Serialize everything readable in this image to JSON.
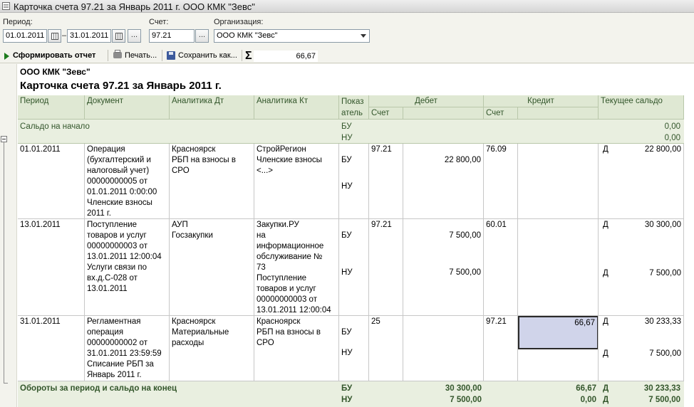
{
  "window": {
    "title": "Карточка счета 97.21 за Январь 2011 г. ООО КМК \"Зевс\""
  },
  "filters": {
    "period_label": "Период:",
    "date_from": "01.01.2011",
    "date_sep": "–",
    "date_to": "31.01.2011",
    "more_button": "...",
    "account_label": "Счет:",
    "account": "97.21",
    "org_label": "Организация:",
    "org": "ООО КМК \"Зевс\""
  },
  "toolbar": {
    "generate": "Сформировать отчет",
    "print": "Печать...",
    "save": "Сохранить как...",
    "sigma": "Σ",
    "sum": "66,67"
  },
  "report": {
    "org": "ООО КМК \"Зевс\"",
    "title": "Карточка счета 97.21 за Январь 2011 г.",
    "headers": {
      "period": "Период",
      "document": "Документ",
      "an_dt": "Аналитика Дт",
      "an_kt": "Аналитика Кт",
      "ind": "Показ\nатель",
      "debit": "Дебет",
      "debit_acc": "Счет",
      "credit": "Кредит",
      "credit_acc": "Счет",
      "balance": "Текущее сальдо"
    },
    "opening": {
      "label": "Сальдо на начало",
      "bu": "БУ",
      "nu": "НУ",
      "bu_val": "0,00",
      "nu_val": "0,00"
    },
    "rows": [
      {
        "period": "01.01.2011",
        "document": "Операция\n(бухгалтерский и\nналоговый учет)\n00000000005 от\n01.01.2011 0:00:00\nЧленские взносы\n2011 г.",
        "an_dt": "Красноярск\nРБП на взносы в\nСРО",
        "an_kt": "СтройРегион\nЧленские взносы\n<...>",
        "bu": "БУ",
        "nu": "НУ",
        "debit_acc": "97.21",
        "debit_bu": "22 800,00",
        "debit_nu": "",
        "credit_acc": "76.09",
        "credit_bu": "",
        "credit_nu": "",
        "bal_sign_bu": "Д",
        "bal_bu": "22 800,00",
        "bal_sign_nu": "",
        "bal_nu": ""
      },
      {
        "period": "13.01.2011",
        "document": "Поступление\nтоваров и услуг\n00000000003 от\n13.01.2011 12:00:04\nУслуги связи по\nвх.д.С-028 от\n13.01.2011",
        "an_dt": "АУП\nГосзакупки",
        "an_kt": "Закупки.РУ\nна\nинформационное\nобслуживание №\n73\nПоступление\nтоваров и услуг\n00000000003 от\n13.01.2011 12:00:04",
        "bu": "БУ",
        "nu": "НУ",
        "debit_acc": "97.21",
        "debit_bu": "7 500,00",
        "debit_nu": "7 500,00",
        "credit_acc": "60.01",
        "credit_bu": "",
        "credit_nu": "",
        "bal_sign_bu": "Д",
        "bal_bu": "30 300,00",
        "bal_sign_nu": "Д",
        "bal_nu": "7 500,00"
      },
      {
        "period": "31.01.2011",
        "document": "Регламентная\nоперация\n00000000002 от\n31.01.2011 23:59:59\nСписание РБП за\nЯнварь 2011 г.",
        "an_dt": "Красноярск\nМатериальные\nрасходы",
        "an_kt": "Красноярск\nРБП на взносы в\nСРО",
        "bu": "БУ",
        "nu": "НУ",
        "debit_acc": "25",
        "debit_bu": "",
        "debit_nu": "",
        "credit_acc": "97.21",
        "credit_bu": "66,67",
        "credit_nu": "",
        "bal_sign_bu": "Д",
        "bal_bu": "30 233,33",
        "bal_sign_nu": "Д",
        "bal_nu": "7 500,00"
      }
    ],
    "totals": {
      "label": "Обороты за период и сальдо на конец",
      "bu": "БУ",
      "nu": "НУ",
      "debit_bu": "30 300,00",
      "debit_nu": "7 500,00",
      "credit_bu": "66,67",
      "credit_nu": "0,00",
      "sign_bu": "Д",
      "bal_bu": "30 233,33",
      "sign_nu": "Д",
      "bal_nu": "7 500,00"
    }
  }
}
